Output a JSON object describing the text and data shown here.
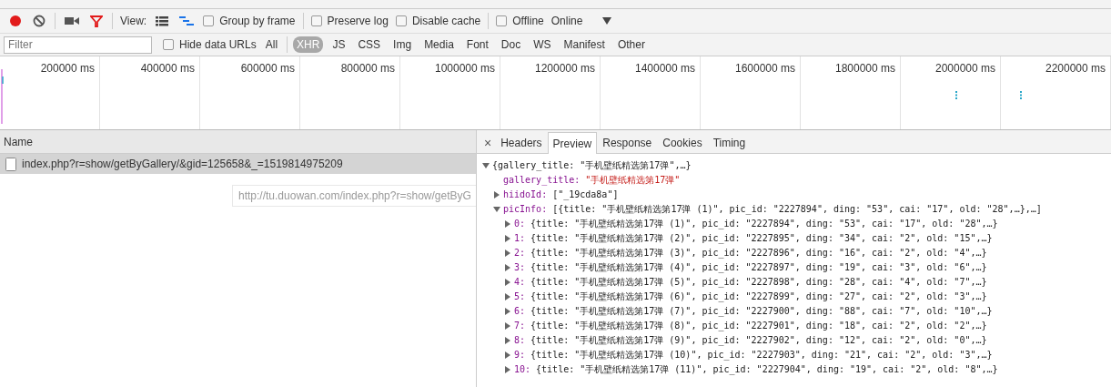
{
  "toolbar": {
    "recording": true,
    "filter_active": true,
    "view_label": "View:",
    "large_rows": false,
    "overview": true,
    "options": [
      {
        "label": "Group by frame",
        "checked": false
      },
      {
        "label": "Preserve log",
        "checked": false
      },
      {
        "label": "Disable cache",
        "checked": false
      },
      {
        "label": "Offline",
        "checked": false
      }
    ],
    "throttling": "Online"
  },
  "filter_bar": {
    "placeholder": "Filter",
    "hide_data_urls": {
      "label": "Hide data URLs",
      "checked": false
    },
    "types": [
      {
        "label": "All",
        "selected": false
      },
      {
        "label": "XHR",
        "selected": true
      },
      {
        "label": "JS",
        "selected": false
      },
      {
        "label": "CSS",
        "selected": false
      },
      {
        "label": "Img",
        "selected": false
      },
      {
        "label": "Media",
        "selected": false
      },
      {
        "label": "Font",
        "selected": false
      },
      {
        "label": "Doc",
        "selected": false
      },
      {
        "label": "WS",
        "selected": false
      },
      {
        "label": "Manifest",
        "selected": false
      },
      {
        "label": "Other",
        "selected": false
      }
    ]
  },
  "overview": {
    "ticks": [
      "200000 ms",
      "400000 ms",
      "600000 ms",
      "800000 ms",
      "1000000 ms",
      "1200000 ms",
      "1400000 ms",
      "1600000 ms",
      "1800000 ms",
      "2000000 ms",
      "2200000 ms"
    ]
  },
  "requests": {
    "header": "Name",
    "rows": [
      {
        "name": "index.php?r=show/getByGallery/&gid=125658&_=1519814975209",
        "selected": true
      }
    ],
    "tooltip": "http://tu.duowan.com/index.php?r=show/getByG"
  },
  "details": {
    "close": "×",
    "tabs": [
      {
        "label": "Headers",
        "selected": false
      },
      {
        "label": "Preview",
        "selected": true
      },
      {
        "label": "Response",
        "selected": false
      },
      {
        "label": "Cookies",
        "selected": false
      },
      {
        "label": "Timing",
        "selected": false
      }
    ],
    "tree": {
      "kind": "object",
      "summary": "{gallery_title: \"手机壁纸精选第17弹\",…}",
      "expanded": true,
      "children": [
        {
          "kind": "string",
          "key": "gallery_title:",
          "value": "\"手机壁纸精选第17弹\""
        },
        {
          "kind": "object",
          "key": "hiidoId:",
          "value": "[\"_19cda8a\"]",
          "expanded": false
        },
        {
          "kind": "object",
          "key": "picInfo:",
          "value": "[{title: \"手机壁纸精选第17弹 (1)\", pic_id: \"2227894\", ding: \"53\", cai: \"17\", old: \"28\",…},…]",
          "expanded": true,
          "children": [
            {
              "kind": "object",
              "key": "0:",
              "value": "{title: \"手机壁纸精选第17弹 (1)\", pic_id: \"2227894\", ding: \"53\", cai: \"17\", old: \"28\",…}",
              "expanded": false
            },
            {
              "kind": "object",
              "key": "1:",
              "value": "{title: \"手机壁纸精选第17弹 (2)\", pic_id: \"2227895\", ding: \"34\", cai: \"2\", old: \"15\",…}",
              "expanded": false
            },
            {
              "kind": "object",
              "key": "2:",
              "value": "{title: \"手机壁纸精选第17弹 (3)\", pic_id: \"2227896\", ding: \"16\", cai: \"2\", old: \"4\",…}",
              "expanded": false
            },
            {
              "kind": "object",
              "key": "3:",
              "value": "{title: \"手机壁纸精选第17弹 (4)\", pic_id: \"2227897\", ding: \"19\", cai: \"3\", old: \"6\",…}",
              "expanded": false
            },
            {
              "kind": "object",
              "key": "4:",
              "value": "{title: \"手机壁纸精选第17弹 (5)\", pic_id: \"2227898\", ding: \"28\", cai: \"4\", old: \"7\",…}",
              "expanded": false
            },
            {
              "kind": "object",
              "key": "5:",
              "value": "{title: \"手机壁纸精选第17弹 (6)\", pic_id: \"2227899\", ding: \"27\", cai: \"2\", old: \"3\",…}",
              "expanded": false
            },
            {
              "kind": "object",
              "key": "6:",
              "value": "{title: \"手机壁纸精选第17弹 (7)\", pic_id: \"2227900\", ding: \"88\", cai: \"7\", old: \"10\",…}",
              "expanded": false
            },
            {
              "kind": "object",
              "key": "7:",
              "value": "{title: \"手机壁纸精选第17弹 (8)\", pic_id: \"2227901\", ding: \"18\", cai: \"2\", old: \"2\",…}",
              "expanded": false
            },
            {
              "kind": "object",
              "key": "8:",
              "value": "{title: \"手机壁纸精选第17弹 (9)\", pic_id: \"2227902\", ding: \"12\", cai: \"2\", old: \"0\",…}",
              "expanded": false
            },
            {
              "kind": "object",
              "key": "9:",
              "value": "{title: \"手机壁纸精选第17弹 (10)\", pic_id: \"2227903\", ding: \"21\", cai: \"2\", old: \"3\",…}",
              "expanded": false
            },
            {
              "kind": "object",
              "key": "10:",
              "value": "{title: \"手机壁纸精选第17弹 (11)\", pic_id: \"2227904\", ding: \"19\", cai: \"2\", old: \"8\",…}",
              "expanded": false
            }
          ]
        }
      ]
    }
  }
}
